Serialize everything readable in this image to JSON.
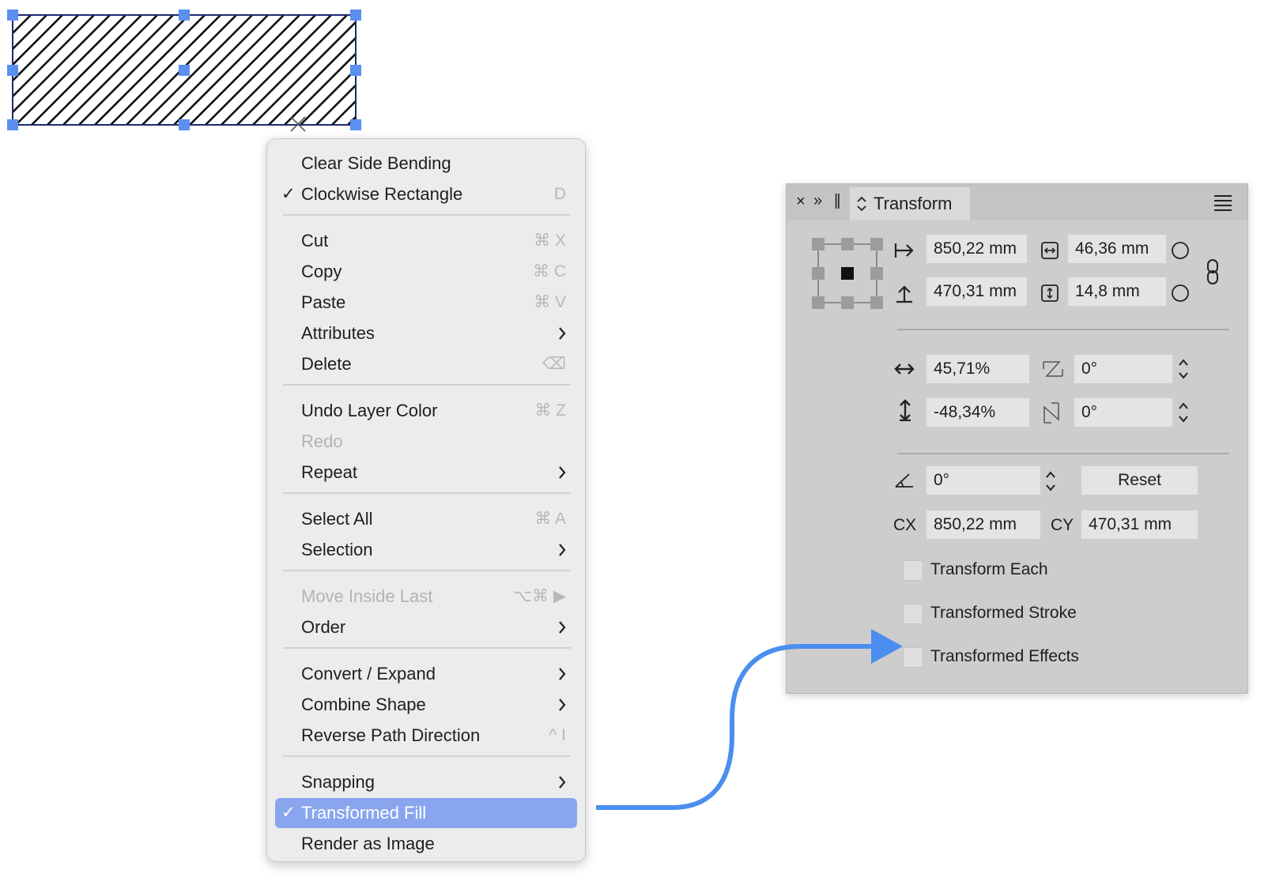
{
  "context_menu": {
    "items": [
      {
        "label": "Clear Side Bending",
        "check": "",
        "shortcut": ""
      },
      {
        "label": "Clockwise Rectangle",
        "check": "✓",
        "shortcut": "D"
      },
      {
        "label": "Cut",
        "check": "",
        "shortcut": "⌘ X"
      },
      {
        "label": "Copy",
        "check": "",
        "shortcut": "⌘ C"
      },
      {
        "label": "Paste",
        "check": "",
        "shortcut": "⌘ V"
      },
      {
        "label": "Attributes",
        "check": "",
        "shortcut": ""
      },
      {
        "label": "Delete",
        "check": "",
        "shortcut": "⌫"
      },
      {
        "label": "Undo Layer Color",
        "check": "",
        "shortcut": "⌘ Z"
      },
      {
        "label": "Redo",
        "check": "",
        "shortcut": ""
      },
      {
        "label": "Repeat",
        "check": "",
        "shortcut": ""
      },
      {
        "label": "Select All",
        "check": "",
        "shortcut": "⌘ A"
      },
      {
        "label": "Selection",
        "check": "",
        "shortcut": ""
      },
      {
        "label": "Move Inside Last",
        "check": "",
        "shortcut": "⌥⌘ ▶"
      },
      {
        "label": "Order",
        "check": "",
        "shortcut": ""
      },
      {
        "label": "Convert / Expand",
        "check": "",
        "shortcut": ""
      },
      {
        "label": "Combine Shape",
        "check": "",
        "shortcut": ""
      },
      {
        "label": "Reverse Path Direction",
        "check": "",
        "shortcut": "^ I"
      },
      {
        "label": "Snapping",
        "check": "",
        "shortcut": ""
      },
      {
        "label": "Transformed Fill",
        "check": "✓",
        "shortcut": ""
      },
      {
        "label": "Render as Image",
        "check": "",
        "shortcut": ""
      }
    ]
  },
  "transform_panel": {
    "toolbar": {
      "close": "×",
      "collapse": "»",
      "grip": "||"
    },
    "title": "Transform",
    "x": "850,22 mm",
    "y": "470,31 mm",
    "width": "46,36 mm",
    "height": "14,8 mm",
    "scale_h": "45,71%",
    "scale_v": "-48,34%",
    "shear_h": "0°",
    "shear_v": "0°",
    "rotation": "0°",
    "reset_label": "Reset",
    "cx_label": "CX",
    "cx": "850,22 mm",
    "cy_label": "CY",
    "cy": "470,31 mm",
    "options": [
      {
        "label": "Transform Each",
        "checked": false
      },
      {
        "label": "Transformed Stroke",
        "checked": false
      },
      {
        "label": "Transformed Effects",
        "checked": false
      }
    ]
  },
  "colors": {
    "selection_handle": "#5b8ff0",
    "menu_highlight": "#89a5ee",
    "callout_arrow": "#4a8ef0",
    "panel_bg": "#cdcdcd"
  }
}
